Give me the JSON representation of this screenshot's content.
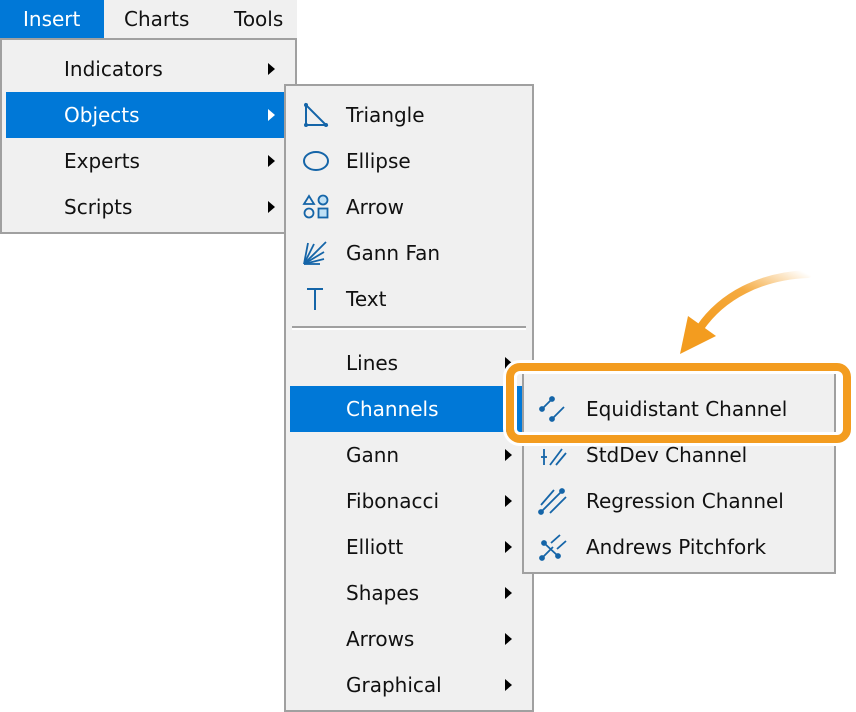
{
  "menubar": {
    "items": [
      {
        "label": "Insert",
        "active": true
      },
      {
        "label": "Charts",
        "active": false
      },
      {
        "label": "Tools",
        "active": false
      }
    ]
  },
  "insert_menu": {
    "items": [
      {
        "label": "Indicators",
        "submenu": true,
        "selected": false
      },
      {
        "label": "Objects",
        "submenu": true,
        "selected": true
      },
      {
        "label": "Experts",
        "submenu": true,
        "selected": false
      },
      {
        "label": "Scripts",
        "submenu": true,
        "selected": false
      }
    ]
  },
  "objects_menu": {
    "items": [
      {
        "label": "Triangle",
        "icon": "triangle-icon"
      },
      {
        "label": "Ellipse",
        "icon": "ellipse-icon"
      },
      {
        "label": "Arrow",
        "icon": "shapes-icon"
      },
      {
        "label": "Gann Fan",
        "icon": "gann-fan-icon"
      },
      {
        "label": "Text",
        "icon": "text-icon"
      }
    ],
    "submenus": [
      {
        "label": "Lines",
        "selected": false
      },
      {
        "label": "Channels",
        "selected": true
      },
      {
        "label": "Gann",
        "selected": false
      },
      {
        "label": "Fibonacci",
        "selected": false
      },
      {
        "label": "Elliott",
        "selected": false
      },
      {
        "label": "Shapes",
        "selected": false
      },
      {
        "label": "Arrows",
        "selected": false
      },
      {
        "label": "Graphical",
        "selected": false
      }
    ]
  },
  "channels_menu": {
    "items": [
      {
        "label": "Equidistant Channel",
        "icon": "equidistant-channel-icon",
        "highlighted": true
      },
      {
        "label": "StdDev Channel",
        "icon": "stddev-channel-icon",
        "highlighted": false
      },
      {
        "label": "Regression Channel",
        "icon": "regression-channel-icon",
        "highlighted": false
      },
      {
        "label": "Andrews Pitchfork",
        "icon": "andrews-pitchfork-icon",
        "highlighted": false
      }
    ]
  },
  "colors": {
    "accent": "#0078d7",
    "menu_bg": "#f0f0f0",
    "menu_border": "#a0a0a0",
    "icon_blue": "#1565a8",
    "callout_orange": "#f39c1f"
  }
}
